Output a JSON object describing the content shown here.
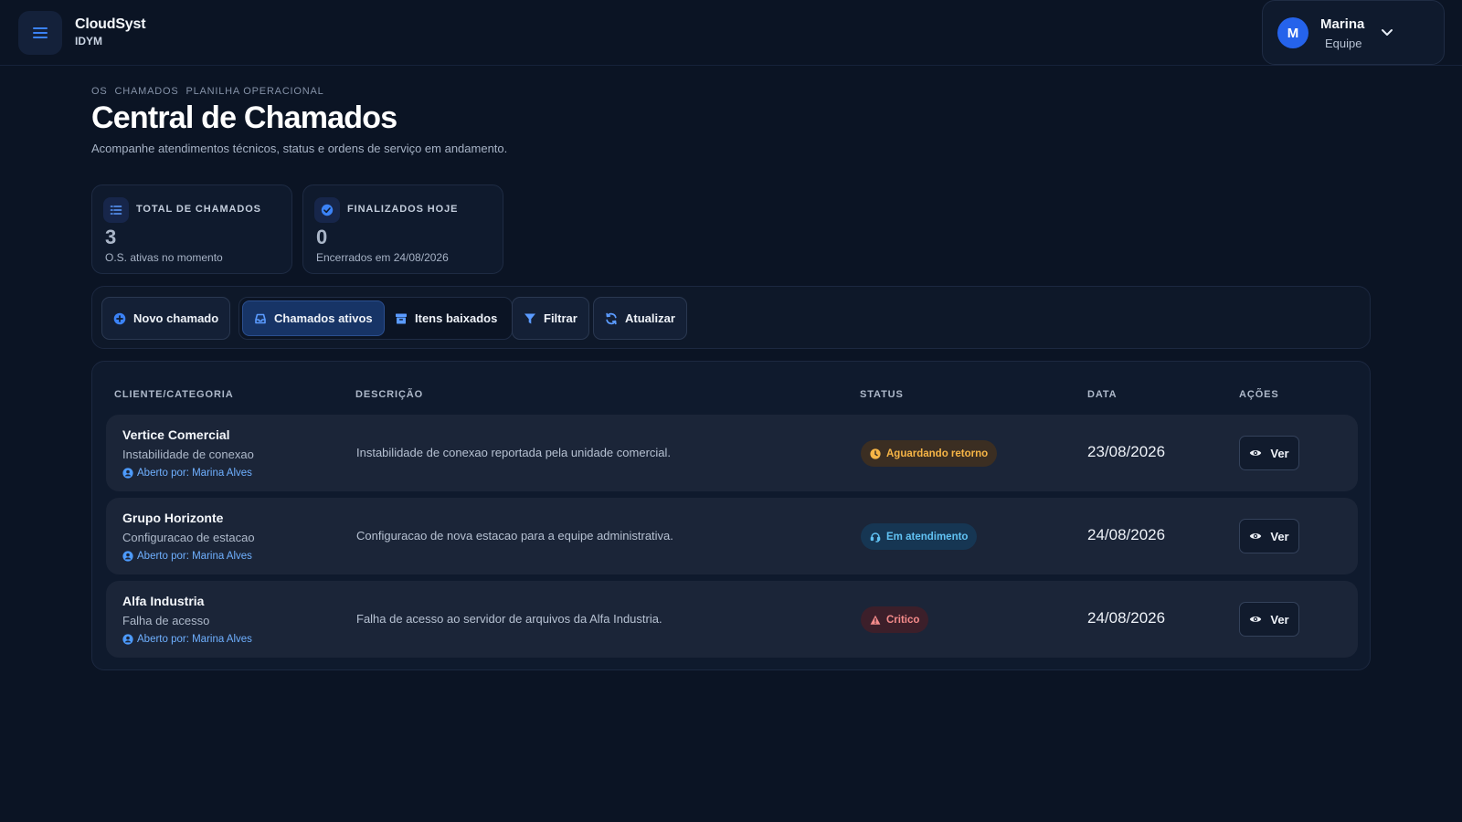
{
  "app": {
    "name": "CloudSyst",
    "subtitle": "IDYM"
  },
  "user": {
    "initial": "M",
    "name": "Marina",
    "role": "Equipe"
  },
  "breadcrumb": [
    "OS",
    "CHAMADOS",
    "PLANILHA OPERACIONAL"
  ],
  "page": {
    "title": "Central de Chamados",
    "subtitle": "Acompanhe atendimentos técnicos, status e ordens de serviço em andamento."
  },
  "stats": [
    {
      "label": "TOTAL DE CHAMADOS",
      "value": "3",
      "note": "O.S. ativas no momento",
      "icon": "list-icon"
    },
    {
      "label": "FINALIZADOS HOJE",
      "value": "0",
      "note": "Encerrados em 24/08/2026",
      "icon": "check-circle-icon"
    }
  ],
  "toolbar": {
    "new_label": "Novo chamado",
    "tab_active_label": "Chamados ativos",
    "tab_archived_label": "Itens baixados",
    "filter_label": "Filtrar",
    "refresh_label": "Atualizar"
  },
  "table": {
    "headers": {
      "client": "CLIENTE/CATEGORIA",
      "description": "DESCRIÇÃO",
      "status": "STATUS",
      "date": "DATA",
      "actions": "AÇÕES"
    },
    "rows": [
      {
        "client": "Vertice Comercial",
        "category": "Instabilidade de conexao",
        "opened_by": "Aberto por: Marina Alves",
        "description": "Instabilidade de conexao reportada pela unidade comercial.",
        "status": "Aguardando retorno",
        "date": "23/08/2026",
        "action": "Ver"
      },
      {
        "client": "Grupo Horizonte",
        "category": "Configuracao de estacao",
        "opened_by": "Aberto por: Marina Alves",
        "description": "Configuracao de nova estacao para a equipe administrativa.",
        "status": "Em atendimento",
        "date": "24/08/2026",
        "action": "Ver"
      },
      {
        "client": "Alfa Industria",
        "category": "Falha de acesso",
        "opened_by": "Aberto por: Marina Alves",
        "description": "Falha de acesso ao servidor de arquivos da Alfa Industria.",
        "status": "Critico",
        "date": "24/08/2026",
        "action": "Ver"
      }
    ]
  },
  "colors": {
    "background": "#0b1424",
    "accent": "#2563eb",
    "status_warning": "#f7b546",
    "status_info": "#61c2f3",
    "status_critical": "#f58b8b"
  }
}
